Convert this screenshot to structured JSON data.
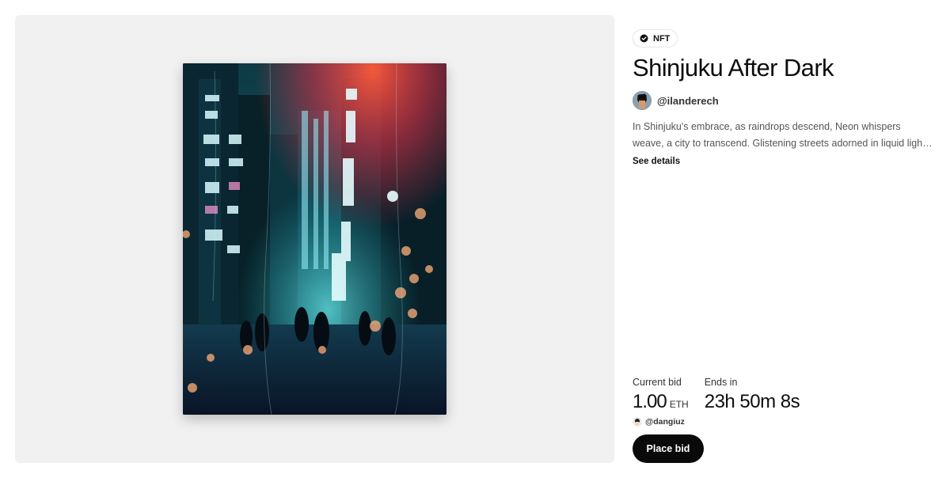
{
  "badge": {
    "label": "NFT",
    "icon": "verified-check-icon"
  },
  "artwork": {
    "title": "Shinjuku After Dark"
  },
  "creator": {
    "handle": "@ilanderech",
    "avatar_icon": "creator-avatar"
  },
  "description": "In Shinjuku's embrace, as raindrops descend, Neon whispers weave, a city to transcend. Glistening streets adorned in liquid light, A dan...",
  "see_details_label": "See details",
  "auction": {
    "current_bid_label": "Current bid",
    "current_bid_amount": "1.00",
    "current_bid_unit": "ETH",
    "ends_in_label": "Ends in",
    "ends_in_value": "23h 50m 8s",
    "top_bidder": "@dangiuz"
  },
  "place_bid_label": "Place bid",
  "colors": {
    "button_bg": "#0a0a0a",
    "panel_bg": "#f1f1f1",
    "text": "#0d0d0d"
  }
}
